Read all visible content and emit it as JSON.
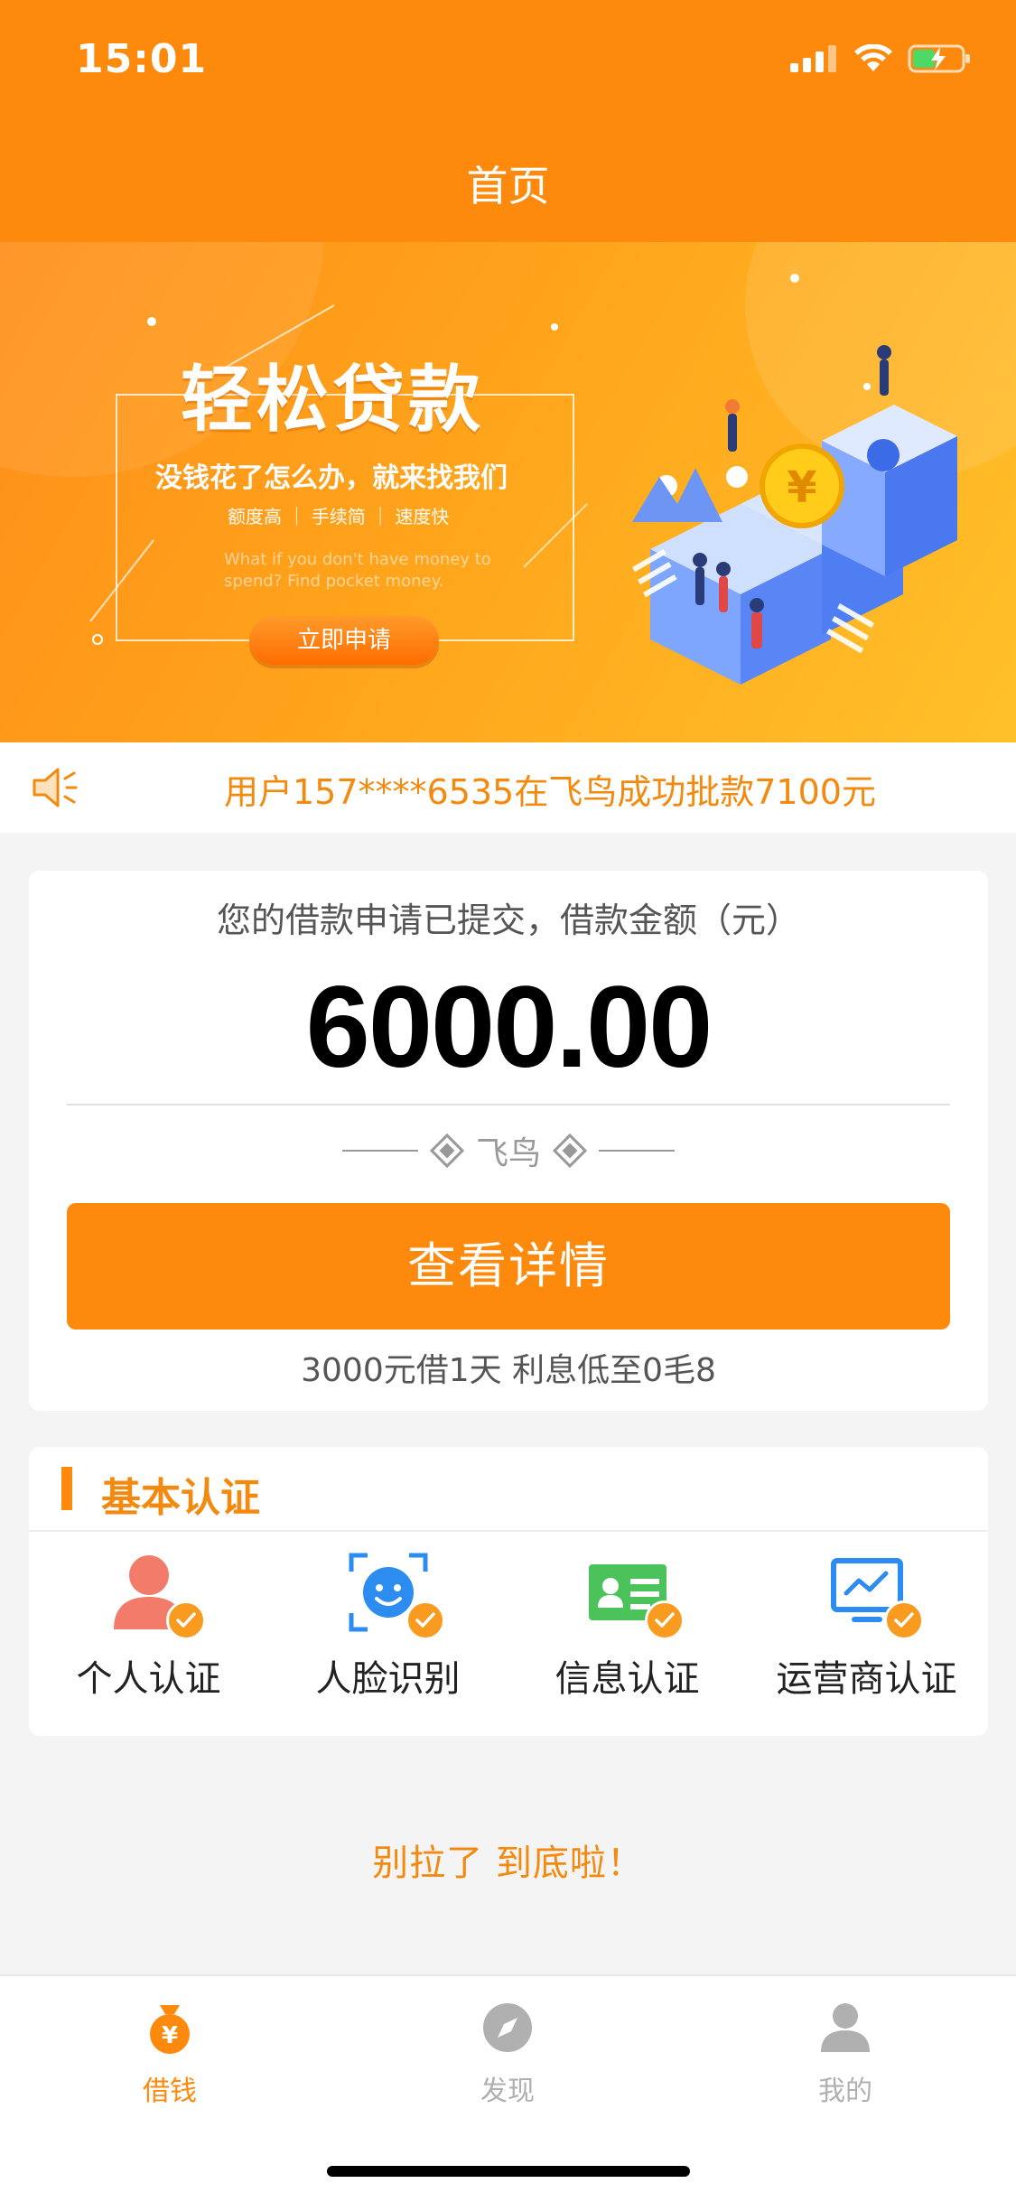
{
  "status_bar": {
    "time": "15:01"
  },
  "header": {
    "title": "首页"
  },
  "banner": {
    "title": "轻松贷款",
    "subtitle": "没钱花了怎么办，就来找我们",
    "tags": "额度高 ｜ 手续简 ｜ 速度快",
    "english": "What if you don't have money to spend? Find pocket money.",
    "button_label": "立即申请"
  },
  "notice": {
    "text": "用户157****6535在飞鸟成功批款7100元"
  },
  "loan": {
    "caption": "您的借款申请已提交，借款金额（元）",
    "amount": "6000.00",
    "brand": "飞鸟",
    "details_button": "查看详情",
    "note": "3000元借1天 利息低至0毛8"
  },
  "verification": {
    "title": "基本认证",
    "items": [
      {
        "label": "个人认证",
        "icon": "person-icon"
      },
      {
        "label": "人脸识别",
        "icon": "face-scan-icon"
      },
      {
        "label": "信息认证",
        "icon": "id-card-icon"
      },
      {
        "label": "运营商认证",
        "icon": "monitor-chart-icon"
      }
    ]
  },
  "end_note": "别拉了 到底啦！",
  "tabbar": {
    "items": [
      {
        "label": "借钱",
        "icon": "money-bag-icon",
        "active": true
      },
      {
        "label": "发现",
        "icon": "compass-icon",
        "active": false
      },
      {
        "label": "我的",
        "icon": "profile-icon",
        "active": false
      }
    ]
  },
  "colors": {
    "accent": "#fd8a0d",
    "text_orange": "#f38a0f",
    "inactive": "#b0b0b0"
  }
}
